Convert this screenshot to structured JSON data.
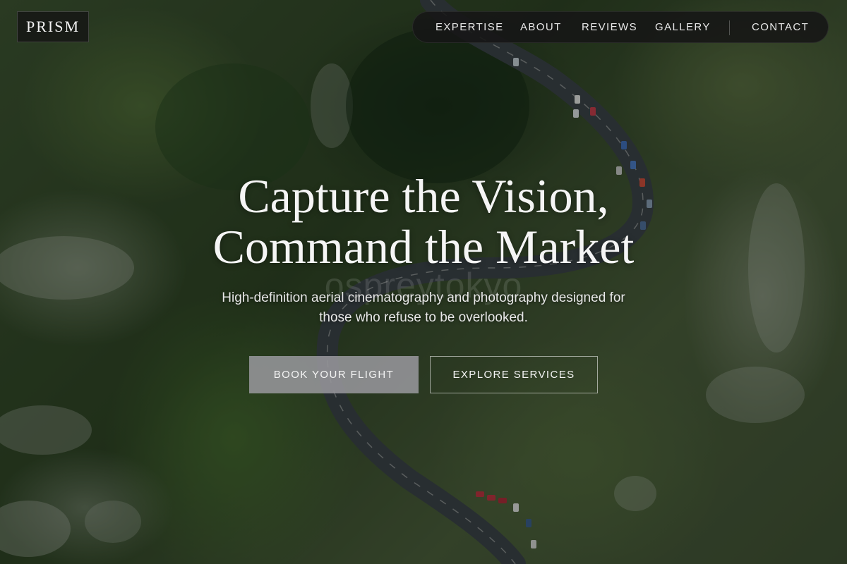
{
  "brand": {
    "name": "PRISM"
  },
  "nav": {
    "items": [
      {
        "label": "EXPERTISE"
      },
      {
        "label": "ABOUT"
      },
      {
        "label": "REVIEWS"
      },
      {
        "label": "GALLERY"
      }
    ],
    "contact_label": "CONTACT"
  },
  "hero": {
    "title_line1": "Capture the Vision,",
    "title_line2": "Command the Market",
    "subtitle_line1": "High-definition aerial cinematography and photography designed for",
    "subtitle_line2": "those who refuse to be overlooked.",
    "watermark": "ospreytokyo",
    "primary_cta": "BOOK YOUR FLIGHT",
    "secondary_cta": "EXPLORE SERVICES"
  },
  "colors": {
    "nav_background": "#161616",
    "primary_button": "#96969b",
    "text": "#f5f5f5"
  }
}
